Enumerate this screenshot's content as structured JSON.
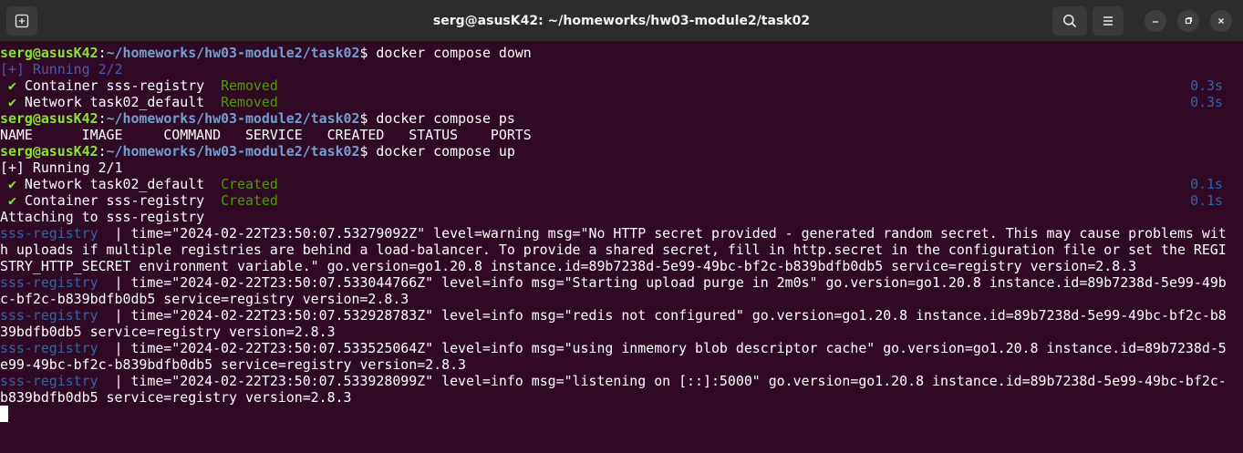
{
  "window": {
    "title": "serg@asusK42: ~/homeworks/hw03-module2/task02",
    "icons": {
      "new_tab": "new-tab-icon",
      "search": "search-icon",
      "menu": "hamburger-menu-icon",
      "minimize": "minimize-icon",
      "maximize": "maximize-icon",
      "close": "close-icon"
    }
  },
  "colors": {
    "background": "#300a24",
    "titlebar": "#2c2c2c",
    "prompt_user": "#8ae234",
    "prompt_path": "#729fcf",
    "status_ok": "#4e9a06",
    "service": "#3465a4"
  },
  "terminal": {
    "prompt": {
      "user": "serg@asusK42",
      "sep": ":",
      "path": "~/homeworks/hw03-module2/task02",
      "dollar": "$ "
    },
    "cmd1": "docker compose down",
    "running1": "[+] Running 2/2",
    "down_items": [
      {
        "check": "✔",
        "text": " Container sss-registry  ",
        "status": "Removed",
        "time": "0.3s"
      },
      {
        "check": "✔",
        "text": " Network task02_default  ",
        "status": "Removed",
        "time": "0.3s"
      }
    ],
    "cmd2": "docker compose ps",
    "ps_header": "NAME      IMAGE     COMMAND   SERVICE   CREATED   STATUS    PORTS",
    "cmd3": "docker compose up",
    "running2": "[+] Running 2/1",
    "up_items": [
      {
        "check": "✔",
        "text": " Network task02_default  ",
        "status": "Created",
        "time": "0.1s"
      },
      {
        "check": "✔",
        "text": " Container sss-registry  ",
        "status": "Created",
        "time": "0.1s"
      }
    ],
    "attaching": "Attaching to sss-registry",
    "service_prefix": "sss-registry  ",
    "log_lines": [
      {
        "svc": true,
        "text": "| time=\"2024-02-22T23:50:07.53279092Z\" level=warning msg=\"No HTTP secret provided - generated random secret. This may cause problems wit"
      },
      {
        "svc": false,
        "text": "h uploads if multiple registries are behind a load-balancer. To provide a shared secret, fill in http.secret in the configuration file or set the REGI"
      },
      {
        "svc": false,
        "text": "STRY_HTTP_SECRET environment variable.\" go.version=go1.20.8 instance.id=89b7238d-5e99-49bc-bf2c-b839bdfb0db5 service=registry version=2.8.3"
      },
      {
        "svc": true,
        "text": "| time=\"2024-02-22T23:50:07.533044766Z\" level=info msg=\"Starting upload purge in 2m0s\" go.version=go1.20.8 instance.id=89b7238d-5e99-49b"
      },
      {
        "svc": false,
        "text": "c-bf2c-b839bdfb0db5 service=registry version=2.8.3"
      },
      {
        "svc": true,
        "text": "| time=\"2024-02-22T23:50:07.532928783Z\" level=info msg=\"redis not configured\" go.version=go1.20.8 instance.id=89b7238d-5e99-49bc-bf2c-b8"
      },
      {
        "svc": false,
        "text": "39bdfb0db5 service=registry version=2.8.3"
      },
      {
        "svc": true,
        "text": "| time=\"2024-02-22T23:50:07.533525064Z\" level=info msg=\"using inmemory blob descriptor cache\" go.version=go1.20.8 instance.id=89b7238d-5"
      },
      {
        "svc": false,
        "text": "e99-49bc-bf2c-b839bdfb0db5 service=registry version=2.8.3"
      },
      {
        "svc": true,
        "text": "| time=\"2024-02-22T23:50:07.533928099Z\" level=info msg=\"listening on [::]:5000\" go.version=go1.20.8 instance.id=89b7238d-5e99-49bc-bf2c-"
      },
      {
        "svc": false,
        "text": "b839bdfb0db5 service=registry version=2.8.3"
      }
    ]
  }
}
